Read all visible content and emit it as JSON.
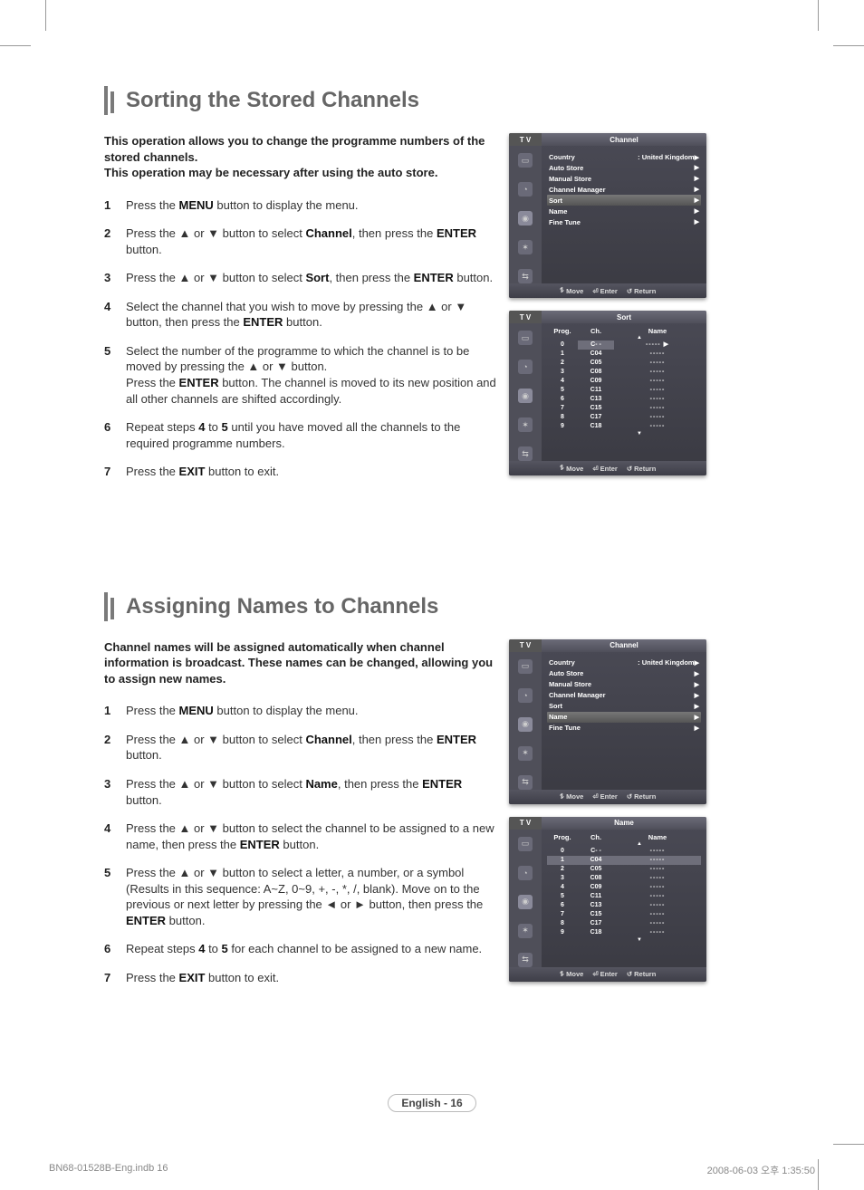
{
  "section1": {
    "title": "Sorting the Stored Channels",
    "intro": "This operation allows you to change the programme numbers of the stored channels.\nThis operation may be necessary after using the auto store.",
    "steps": {
      "s1": "Press the <b>MENU</b> button to display the menu.",
      "s2": "Press the ▲ or ▼ button to select <b>Channel</b>, then press the <b>ENTER</b> button.",
      "s3": "Press the ▲ or ▼ button to select <b>Sort</b>, then press the <b>ENTER</b> button.",
      "s4": "Select the channel that you wish to move by pressing the ▲ or ▼ button, then press the <b>ENTER</b> button.",
      "s5": "Select the number of the programme to which the channel is to be moved by pressing the ▲ or ▼ button.<br>Press the <b>ENTER</b> button. The channel is moved to its new position and all other channels are shifted accordingly.",
      "s6": "Repeat steps <b>4</b> to <b>5</b> until you have moved all the channels to the required programme numbers.",
      "s7": "Press the <b>EXIT</b> button to exit."
    }
  },
  "section2": {
    "title": "Assigning Names to Channels",
    "intro": "Channel names will be assigned automatically when channel information is broadcast. These names can be changed, allowing you to assign new names.",
    "steps": {
      "s1": "Press the <b>MENU</b> button to display the menu.",
      "s2": "Press the ▲ or ▼ button to select <b>Channel</b>, then press the <b>ENTER</b> button.",
      "s3": "Press the ▲ or ▼ button to select <b>Name</b>, then press the <b>ENTER</b> button.",
      "s4": "Press the ▲ or ▼ button to select the channel to be assigned to a new name, then press the <b>ENTER</b> button.",
      "s5": "Press the ▲ or ▼ button to select a letter, a number, or a symbol (Results in this sequence: A~Z, 0~9, +, -, *, /, blank). Move on to the previous or next letter by pressing the ◄ or ► button, then press the <b>ENTER</b> button.",
      "s6": "Repeat steps <b>4</b> to <b>5</b> for each channel to be assigned to a new name.",
      "s7": "Press the <b>EXIT</b> button to exit."
    }
  },
  "osd": {
    "tv": "T V",
    "channel_title": "Channel",
    "sort_title": "Sort",
    "name_title": "Name",
    "menu": {
      "country": "Country",
      "country_val": ": United Kingdom",
      "auto_store": "Auto Store",
      "manual_store": "Manual Store",
      "channel_manager": "Channel Manager",
      "sort": "Sort",
      "name": "Name",
      "fine_tune": "Fine Tune"
    },
    "footer": {
      "move": "Move",
      "enter": "Enter",
      "return": "Return"
    },
    "cols": {
      "prog": "Prog.",
      "ch": "Ch.",
      "name": "Name"
    },
    "rows": [
      {
        "p": "0",
        "c": "C- -",
        "n": "-----"
      },
      {
        "p": "1",
        "c": "C04",
        "n": "-----"
      },
      {
        "p": "2",
        "c": "C05",
        "n": "-----"
      },
      {
        "p": "3",
        "c": "C08",
        "n": "-----"
      },
      {
        "p": "4",
        "c": "C09",
        "n": "-----"
      },
      {
        "p": "5",
        "c": "C11",
        "n": "-----"
      },
      {
        "p": "6",
        "c": "C13",
        "n": "-----"
      },
      {
        "p": "7",
        "c": "C15",
        "n": "-----"
      },
      {
        "p": "8",
        "c": "C17",
        "n": "-----"
      },
      {
        "p": "9",
        "c": "C18",
        "n": "-----"
      }
    ]
  },
  "footer": {
    "center": "English - 16",
    "left": "BN68-01528B-Eng.indb   16",
    "right": "2008-06-03   오후 1:35:50"
  }
}
